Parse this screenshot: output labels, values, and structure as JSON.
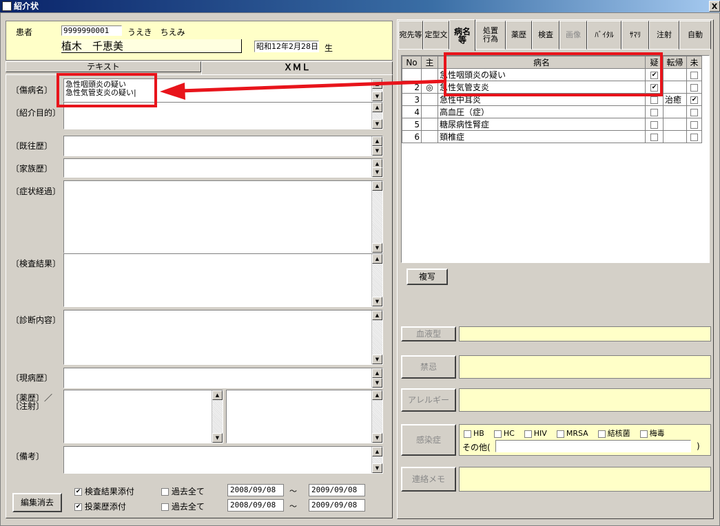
{
  "window": {
    "title": "紹介状",
    "close": "X"
  },
  "patient": {
    "label": "患者",
    "id": "9999990001",
    "kana": "うえき　ちえみ",
    "name": "植木　千恵美",
    "birth": "昭和12年2月28日",
    "birth_suffix": "生"
  },
  "left_tabs": [
    "テキスト",
    "ＸＭＬ"
  ],
  "fields": [
    {
      "label": "〔傷病名〕",
      "value": "急性咽頭炎の疑い\n急性気管支炎の疑い|"
    },
    {
      "label": "〔紹介目的〕",
      "value": ""
    },
    {
      "label": "〔既往歴〕",
      "value": ""
    },
    {
      "label": "〔家族歴〕",
      "value": ""
    },
    {
      "label": "〔症状経過〕",
      "value": ""
    },
    {
      "label": "〔検査結果〕",
      "value": ""
    },
    {
      "label": "〔診断内容〕",
      "value": ""
    },
    {
      "label": "〔現病歴〕",
      "value": ""
    },
    {
      "label": "〔薬歴〕／\n〔注射〕",
      "value": ""
    },
    {
      "label": "〔備考〕",
      "value": ""
    }
  ],
  "attach": {
    "exam": "検査結果添付",
    "drug": "投薬歴添付",
    "all1": "過去全て",
    "all2": "過去全て",
    "from1": "2008/09/08",
    "to1": "2009/09/08",
    "from2": "2008/09/08",
    "to2": "2009/09/08",
    "tilde": "～",
    "clear_button": "編集消去"
  },
  "right_tabs": [
    "宛先等",
    "定型文",
    "病名等",
    "処置行為",
    "薬歴",
    "検査",
    "画像",
    "ﾊﾞｲﾀﾙ",
    "ｻﾏﾘ",
    "注射",
    "自動"
  ],
  "disease_table": {
    "headers": [
      "No",
      "主",
      "病名",
      "疑",
      "転帰",
      "未"
    ],
    "rows": [
      {
        "no": "",
        "main": "",
        "name": "急性咽頭炎の疑い",
        "susp": "✔",
        "outcome": "",
        "unf": ""
      },
      {
        "no": "2",
        "main": "◎",
        "name": "急性気管支炎",
        "susp": "✔",
        "outcome": "",
        "unf": ""
      },
      {
        "no": "3",
        "main": "",
        "name": "急性中耳炎",
        "susp": "",
        "outcome": "治癒",
        "unf": "✔"
      },
      {
        "no": "4",
        "main": "",
        "name": "高血圧（症）",
        "susp": "",
        "outcome": "",
        "unf": ""
      },
      {
        "no": "5",
        "main": "",
        "name": "糖尿病性腎症",
        "susp": "",
        "outcome": "",
        "unf": ""
      },
      {
        "no": "6",
        "main": "",
        "name": "頚椎症",
        "susp": "",
        "outcome": "",
        "unf": ""
      }
    ]
  },
  "copy_button": "複写",
  "info": {
    "blood": "血液型",
    "taboo": "禁忌",
    "allergy": "アレルギー",
    "infection": "感染症",
    "memo": "連絡メモ",
    "inf_items": [
      "HB",
      "HC",
      "HIV",
      "MRSA",
      "結核菌",
      "梅毒"
    ],
    "other": "その他(",
    "other_close": ")"
  },
  "colors": {
    "highlight": "#e8141b",
    "field_yellow": "#ffffc8"
  }
}
